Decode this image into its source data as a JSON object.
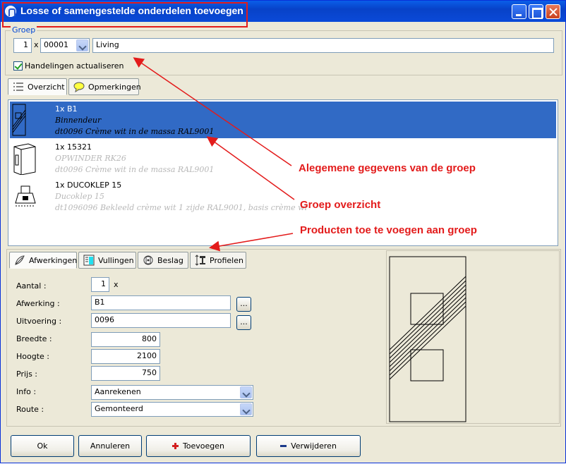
{
  "window": {
    "title": "Losse of samengestelde onderdelen toevoegen"
  },
  "group": {
    "label": "Groep",
    "quantity": "1",
    "times": "x",
    "code": "00001",
    "name": "Living",
    "update_checkbox_label": "Handelingen actualiseren",
    "update_checked": true
  },
  "tabs_top": [
    {
      "label": "Overzicht",
      "icon": "list-icon",
      "active": true
    },
    {
      "label": "Opmerkingen",
      "icon": "speech-bubble-icon",
      "active": false
    }
  ],
  "overview_list": [
    {
      "title": "1x B1",
      "desc1": "Binnendeur",
      "desc2": "dt0096 Crème wit in de massa RAL9001",
      "selected": true
    },
    {
      "title": "1x 15321",
      "desc1": "OPWINDER RK26",
      "desc2": "dt0096 Crème wit in de massa RAL9001",
      "selected": false
    },
    {
      "title": "1x DUCOKLEP 15",
      "desc1": "Ducoklep 15",
      "desc2": "dt1096096 Bekleeld crème wit 1 zijde RAL9001, basis crème wi",
      "selected": false
    }
  ],
  "tabs_bottom": [
    {
      "label": "Afwerkingen",
      "icon": "finishing-icon",
      "active": true
    },
    {
      "label": "Vullingen",
      "icon": "fill-icon",
      "active": false
    },
    {
      "label": "Beslag",
      "icon": "hardware-icon",
      "active": false
    },
    {
      "label": "Profielen",
      "icon": "profile-icon",
      "active": false
    }
  ],
  "form": {
    "aantal": {
      "label": "Aantal :",
      "value": "1",
      "suffix": "x"
    },
    "afwerking": {
      "label": "Afwerking :",
      "value": "B1",
      "browse": "..."
    },
    "uitvoering": {
      "label": "Uitvoering :",
      "value": "0096",
      "browse": "..."
    },
    "breedte": {
      "label": "Breedte :",
      "value": "800"
    },
    "hoogte": {
      "label": "Hoogte :",
      "value": "2100"
    },
    "prijs": {
      "label": "Prijs :",
      "value": "750"
    },
    "info": {
      "label": "Info :",
      "value": "Aanrekenen"
    },
    "route": {
      "label": "Route :",
      "value": "Gemonteerd"
    }
  },
  "buttons": {
    "ok": "Ok",
    "cancel": "Annuleren",
    "add": "Toevoegen",
    "remove": "Verwijderen"
  },
  "annotations": {
    "general": "Alegemene gegevens van de groep",
    "overview": "Groep overzicht",
    "products": "Producten toe te voegen aan groep"
  },
  "colors": {
    "title_bar": "#0a4ad8",
    "selection": "#316ac5",
    "annotation": "#e31b1b"
  }
}
